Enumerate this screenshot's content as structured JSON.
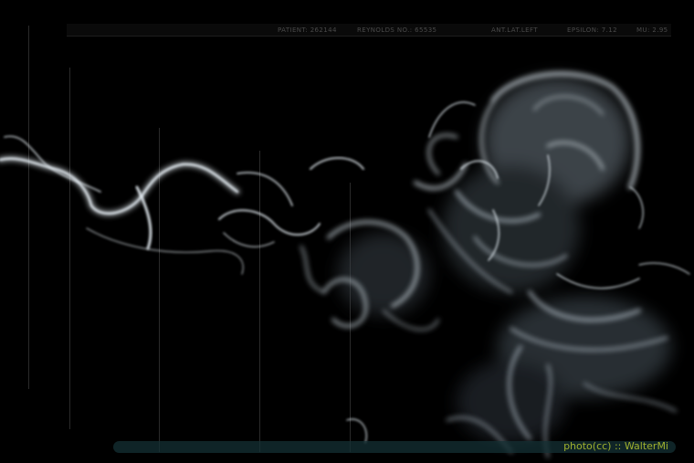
{
  "hud": {
    "patient": "PATIENT: 262144",
    "reynolds": "REYNOLDS NO.: 65535",
    "view": "ANT.LAT.LEFT",
    "epsilon": "EPSILON: 7.12",
    "mu": "MU: 2.95"
  },
  "credit": "photo(cc) :: WalterMi",
  "colors": {
    "background": "#000000",
    "hud_text": "#4a4a4a",
    "credit_text": "#9fb02e",
    "smoke": "#d8e4ec"
  }
}
